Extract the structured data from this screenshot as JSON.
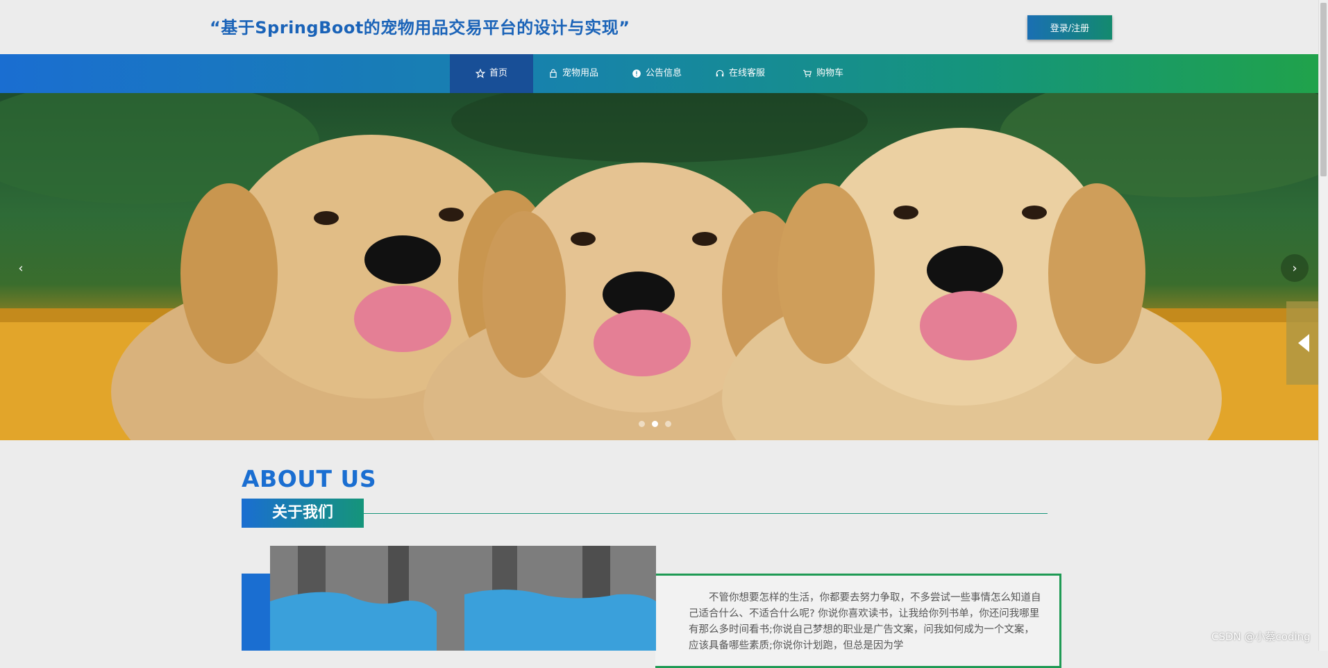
{
  "header": {
    "title": "“基于SpringBoot的宠物用品交易平台的设计与实现”",
    "login_label": "登录/注册"
  },
  "nav": {
    "items": [
      {
        "label": "首页",
        "icon": "star-icon",
        "active": true
      },
      {
        "label": "宠物用品",
        "icon": "bag-icon"
      },
      {
        "label": "公告信息",
        "icon": "info-icon"
      },
      {
        "label": "在线客服",
        "icon": "headset-icon"
      },
      {
        "label": "购物车",
        "icon": "cart-icon"
      }
    ]
  },
  "banner": {
    "image": "three golden retriever puppies on yellow bench",
    "prev_arrow": "‹",
    "next_arrow": "›",
    "slide_count": 3,
    "active_slide": 2
  },
  "about": {
    "title_en": "ABOUT US",
    "title_zh": "关于我们",
    "text": "不管你想要怎样的生活，你都要去努力争取，不多尝试一些事情怎么知道自己适合什么、不适合什么呢? 你说你喜欢读书，让我给你列书单，你还问我哪里有那么多时间看书;你说自己梦想的职业是广告文案，问我如何成为一个文案，应该具备哪些素质;你说你计划跑，但总是因为学"
  },
  "watermark": "CSDN @小蔡coding",
  "colors": {
    "accent_blue": "#1a6ed1",
    "accent_green": "#15957a",
    "nav_active": "#184f97"
  }
}
